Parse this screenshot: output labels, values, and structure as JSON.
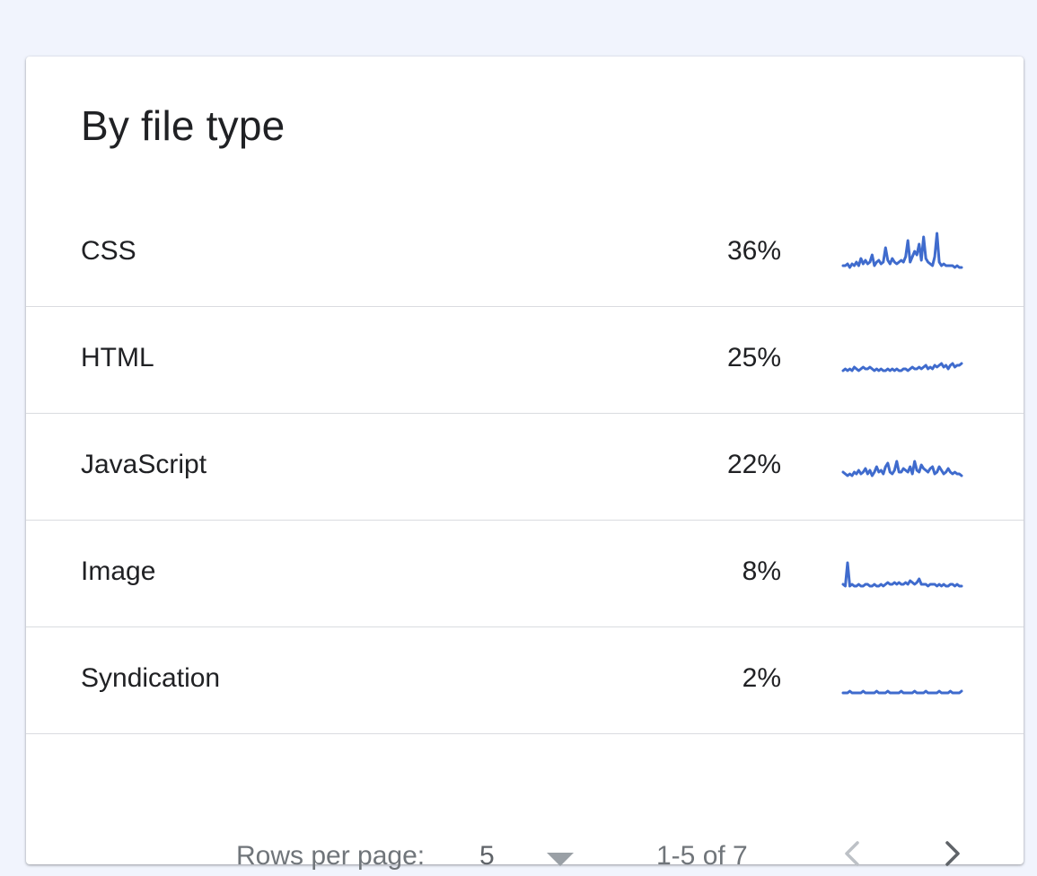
{
  "card": {
    "title": "By file type"
  },
  "colors": {
    "sparkline": "#3f6bcd",
    "nav_disabled": "#bdc1c6",
    "nav_enabled": "#5f6368"
  },
  "rows": [
    {
      "label": "CSS",
      "percent": "36%",
      "sparkline": [
        2,
        2,
        3,
        1,
        3,
        2,
        4,
        2,
        6,
        3,
        5,
        3,
        4,
        8,
        2,
        4,
        5,
        3,
        4,
        12,
        5,
        3,
        6,
        4,
        3,
        4,
        5,
        4,
        7,
        16,
        4,
        7,
        10,
        8,
        14,
        5,
        18,
        6,
        4,
        3,
        2,
        7,
        20,
        4,
        2,
        3,
        2,
        2,
        2,
        2,
        1,
        2,
        1,
        1
      ]
    },
    {
      "label": "HTML",
      "percent": "25%",
      "sparkline": [
        3,
        4,
        3,
        4,
        3,
        5,
        4,
        3,
        4,
        5,
        4,
        4,
        5,
        4,
        3,
        4,
        3,
        4,
        3,
        3,
        4,
        3,
        4,
        3,
        4,
        3,
        3,
        4,
        4,
        3,
        4,
        5,
        4,
        4,
        5,
        4,
        5,
        6,
        4,
        5,
        4,
        6,
        5,
        6,
        7,
        5,
        6,
        4,
        6,
        7,
        5,
        6,
        6,
        7
      ]
    },
    {
      "label": "JavaScript",
      "percent": "22%",
      "sparkline": [
        6,
        5,
        4,
        5,
        4,
        6,
        5,
        7,
        5,
        6,
        8,
        5,
        7,
        4,
        6,
        9,
        6,
        7,
        5,
        9,
        11,
        6,
        5,
        7,
        12,
        6,
        6,
        8,
        7,
        6,
        9,
        5,
        12,
        7,
        6,
        10,
        8,
        7,
        6,
        8,
        9,
        5,
        6,
        9,
        7,
        5,
        6,
        8,
        6,
        5,
        6,
        5,
        5,
        4
      ]
    },
    {
      "label": "Image",
      "percent": "8%",
      "sparkline": [
        3,
        2,
        15,
        2,
        3,
        2,
        2,
        3,
        2,
        2,
        3,
        3,
        2,
        2,
        3,
        2,
        2,
        3,
        2,
        3,
        4,
        3,
        3,
        4,
        3,
        4,
        3,
        3,
        4,
        3,
        5,
        4,
        3,
        4,
        6,
        3,
        3,
        3,
        2,
        3,
        3,
        3,
        2,
        3,
        2,
        3,
        2,
        2,
        3,
        3,
        2,
        3,
        2,
        2
      ]
    },
    {
      "label": "Syndication",
      "percent": "2%",
      "sparkline": [
        2,
        2,
        2,
        3,
        2,
        2,
        2,
        2,
        2,
        3,
        2,
        2,
        2,
        2,
        2,
        3,
        2,
        2,
        2,
        2,
        3,
        2,
        2,
        2,
        2,
        2,
        3,
        2,
        2,
        2,
        2,
        2,
        3,
        2,
        2,
        2,
        2,
        3,
        2,
        2,
        2,
        2,
        2,
        3,
        2,
        2,
        2,
        2,
        3,
        2,
        2,
        2,
        2,
        3
      ]
    }
  ],
  "pagination": {
    "rows_per_page_label": "Rows per page:",
    "rows_per_page_value": "5",
    "range": "1-5 of 7",
    "prev_enabled": false,
    "next_enabled": true
  }
}
